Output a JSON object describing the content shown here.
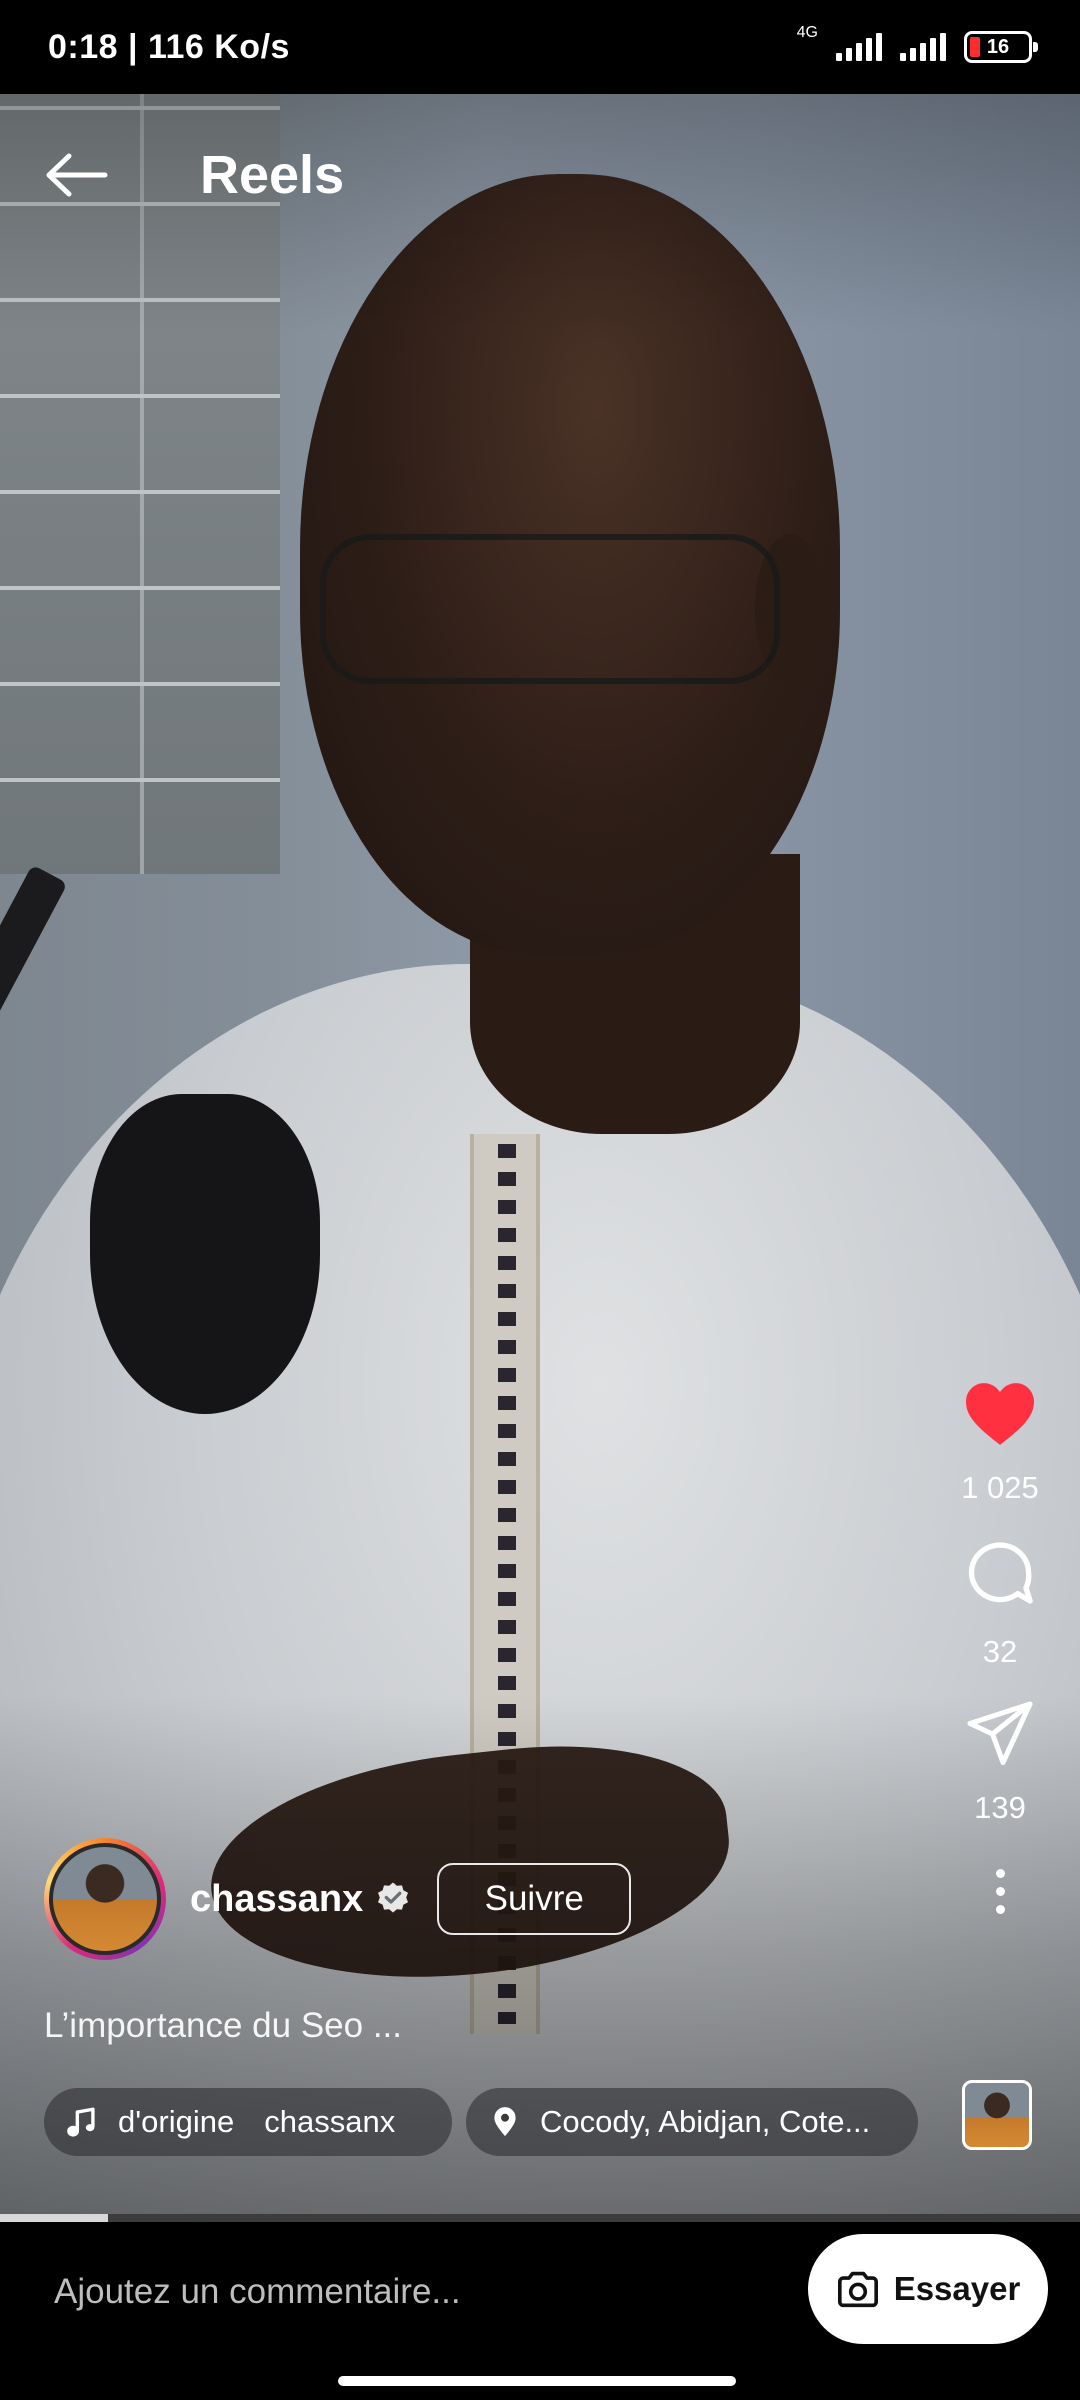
{
  "status_bar": {
    "time_speed": "0:18 | 116 Ko/s",
    "network_label": "4G",
    "battery_level": "16"
  },
  "header": {
    "title": "Reels"
  },
  "actions": {
    "likes": "1 025",
    "comments": "32",
    "shares": "139",
    "liked": true,
    "like_color": "#ff3040"
  },
  "author": {
    "username": "chassanx",
    "follow_label": "Suivre"
  },
  "caption": "L’importance du Seo ...",
  "audio": {
    "label": "d'origine",
    "artist": "chassanx"
  },
  "location": "Cocody, Abidjan, Cote...",
  "progress": 0.1,
  "comment_bar": {
    "placeholder": "Ajoutez un commentaire...",
    "try_label": "Essayer"
  }
}
